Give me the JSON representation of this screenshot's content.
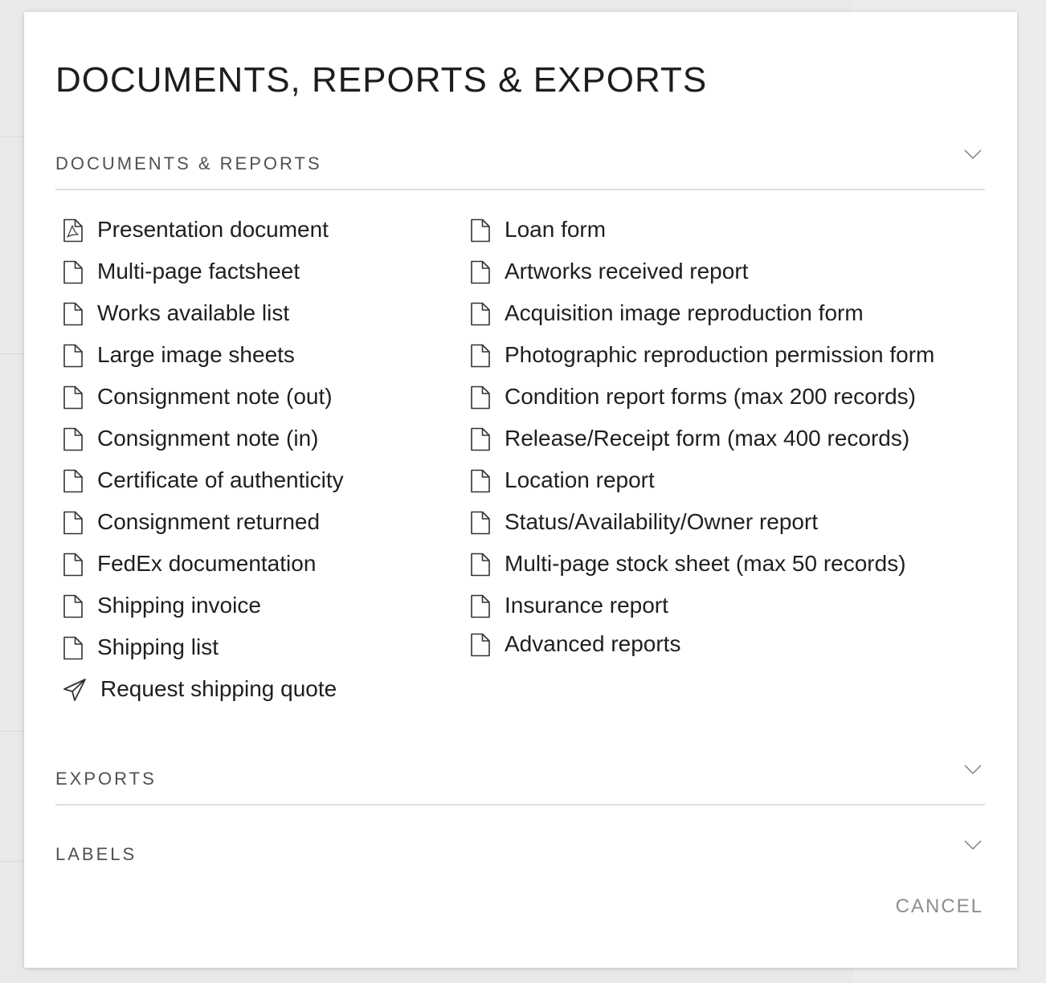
{
  "modal": {
    "title": "DOCUMENTS, REPORTS & EXPORTS",
    "cancel_label": "CANCEL"
  },
  "sections": {
    "documents_reports": {
      "label": "DOCUMENTS & REPORTS",
      "left_items": [
        {
          "label": "Presentation document",
          "icon": "pdf-file-icon"
        },
        {
          "label": "Multi-page factsheet",
          "icon": "file-icon"
        },
        {
          "label": "Works available list",
          "icon": "file-icon"
        },
        {
          "label": "Large image sheets",
          "icon": "file-icon"
        },
        {
          "label": "Consignment note (out)",
          "icon": "file-icon"
        },
        {
          "label": "Consignment note (in)",
          "icon": "file-icon"
        },
        {
          "label": "Certificate of authenticity",
          "icon": "file-icon"
        },
        {
          "label": "Consignment returned",
          "icon": "file-icon"
        },
        {
          "label": "FedEx documentation",
          "icon": "file-icon"
        },
        {
          "label": "Shipping invoice",
          "icon": "file-icon"
        },
        {
          "label": "Shipping list",
          "icon": "file-icon"
        },
        {
          "label": "Request shipping quote",
          "icon": "paper-plane-icon"
        }
      ],
      "right_items": [
        {
          "label": "Loan form",
          "icon": "file-icon"
        },
        {
          "label": "Artworks received report",
          "icon": "file-icon"
        },
        {
          "label": "Acquisition image reproduction form",
          "icon": "file-icon"
        },
        {
          "label": "Photographic reproduction permission form",
          "icon": "file-icon"
        },
        {
          "label": "Condition report forms (max 200 records)",
          "icon": "file-icon"
        },
        {
          "label": "Release/Receipt form (max 400 records)",
          "icon": "file-icon"
        },
        {
          "label": "Location report",
          "icon": "file-icon"
        },
        {
          "label": "Status/Availability/Owner report",
          "icon": "file-icon"
        },
        {
          "label": "Multi-page stock sheet (max 50 records)",
          "icon": "file-icon"
        },
        {
          "label": "Insurance report",
          "icon": "file-icon"
        },
        {
          "label": "Advanced reports",
          "icon": "file-icon"
        }
      ]
    },
    "exports": {
      "label": "EXPORTS"
    },
    "labels": {
      "label": "LABELS"
    }
  },
  "colors": {
    "text": "#1f1f1f",
    "section_label": "#4d5258",
    "divider": "#dedede",
    "cancel": "#8a8e93"
  }
}
